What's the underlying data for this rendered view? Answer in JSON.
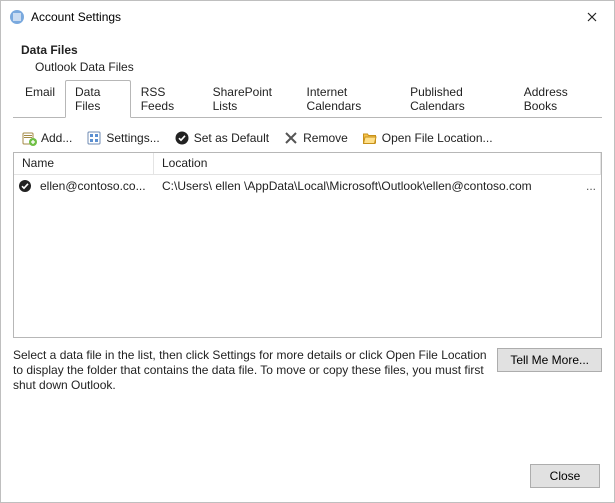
{
  "window": {
    "title": "Account Settings"
  },
  "header": {
    "title": "Data Files",
    "subtitle": "Outlook Data Files"
  },
  "tabs": {
    "email": "Email",
    "datafiles": "Data Files",
    "rss": "RSS Feeds",
    "sharepoint": "SharePoint Lists",
    "internetcal": "Internet Calendars",
    "pubcal": "Published Calendars",
    "addressbooks": "Address Books"
  },
  "toolbar": {
    "add": "Add...",
    "settings": "Settings...",
    "setdefault": "Set as Default",
    "remove": "Remove",
    "openloc": "Open File Location..."
  },
  "columns": {
    "name": "Name",
    "location": "Location"
  },
  "rows": [
    {
      "name": "ellen@contoso.co...",
      "location": "C:\\Users\\  ellen   \\AppData\\Local\\Microsoft\\Outlook\\ellen@contoso.com",
      "ellipsis": "..."
    }
  ],
  "hint": "Select a data file in the list, then click Settings for more details or click Open File Location to display the folder that contains the data file. To move or copy these files, you must first shut down Outlook.",
  "buttons": {
    "tellmemore": "Tell Me More...",
    "close": "Close"
  }
}
